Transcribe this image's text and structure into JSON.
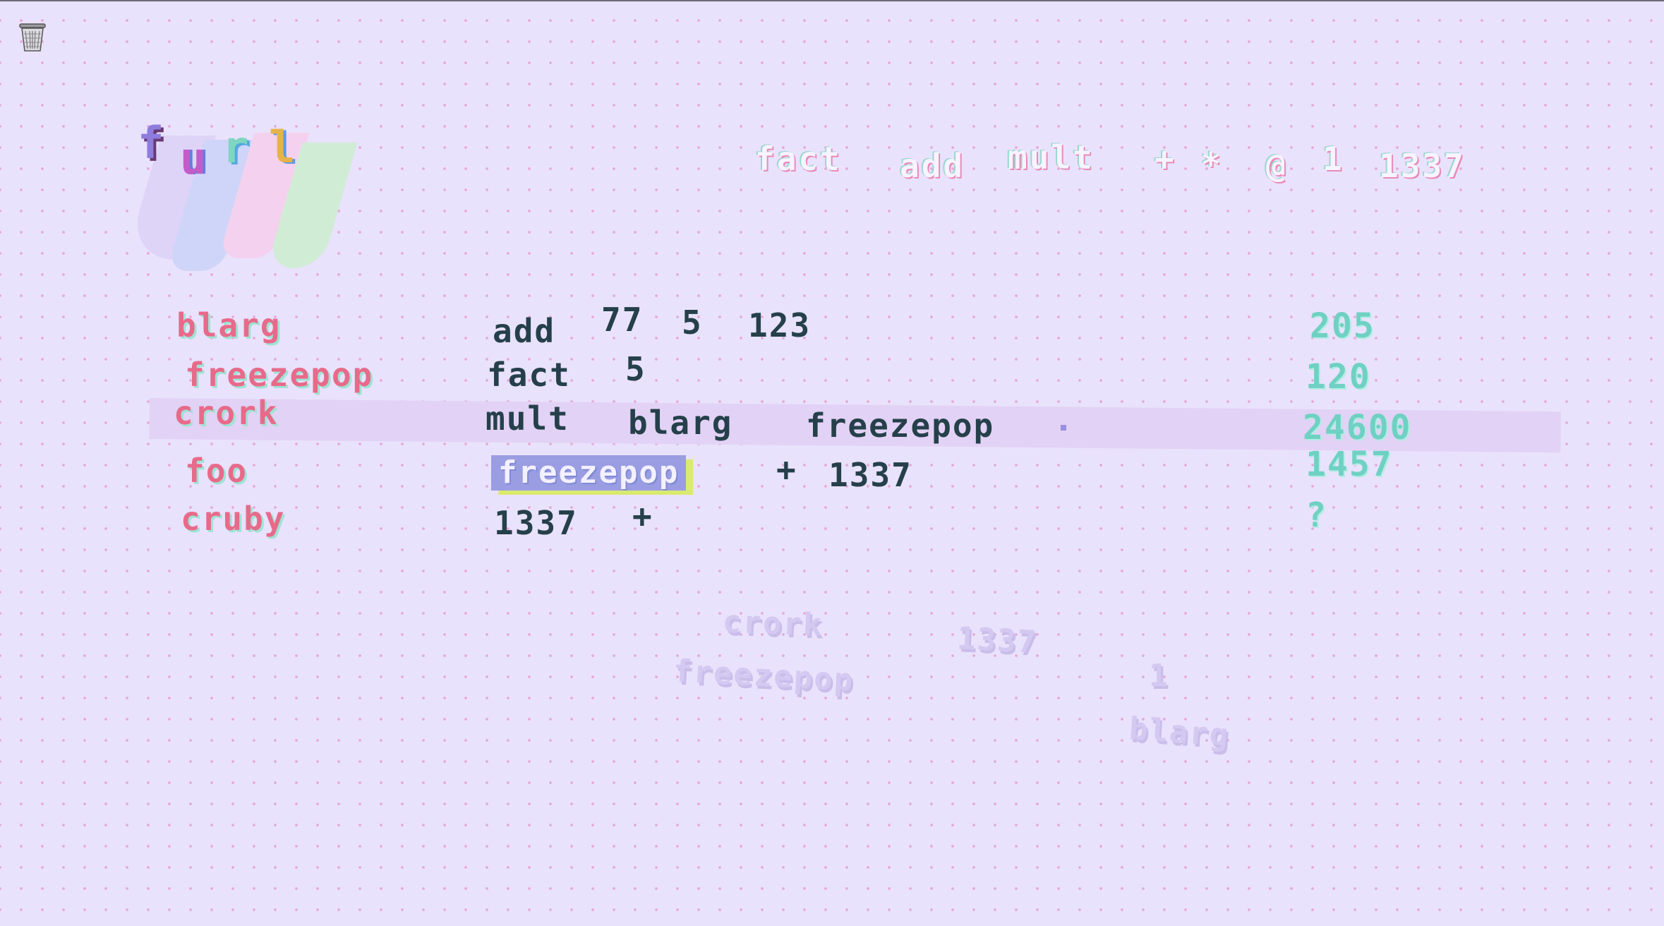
{
  "palette": [
    "fact",
    "add",
    "mult",
    "+",
    "*",
    "@",
    "1",
    "1337"
  ],
  "rows": [
    {
      "name": "blarg",
      "expr": [
        "add",
        "77",
        "5",
        "123"
      ],
      "result": "205"
    },
    {
      "name": "freezepop",
      "expr": [
        "fact",
        "5"
      ],
      "result": "120"
    },
    {
      "name": "crork",
      "expr": [
        "mult",
        "blarg",
        "freezepop"
      ],
      "result": "24600"
    },
    {
      "name": "foo",
      "expr": [
        "freezepop",
        "+",
        "1337"
      ],
      "result": "1457"
    },
    {
      "name": "cruby",
      "expr": [
        "1337",
        "+"
      ],
      "result": "?"
    }
  ],
  "ghosts": [
    "crork",
    "1337",
    "freezepop",
    "1",
    "blarg"
  ],
  "colors": {
    "background": "#e9e2fc",
    "name": "#e86a8a",
    "expr": "#25404a",
    "result": "#6fd1c3",
    "selection": "#9a9de2"
  }
}
